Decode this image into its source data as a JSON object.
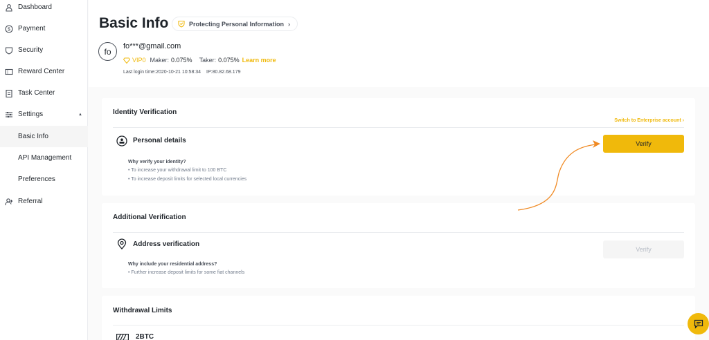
{
  "sidebar": {
    "items": [
      {
        "label": "Dashboard",
        "icon": "user-icon"
      },
      {
        "label": "Payment",
        "icon": "dollar-icon"
      },
      {
        "label": "Security",
        "icon": "shield-icon"
      },
      {
        "label": "Reward Center",
        "icon": "ticket-icon"
      },
      {
        "label": "Task Center",
        "icon": "clipboard-icon"
      },
      {
        "label": "Settings",
        "icon": "sliders-icon"
      },
      {
        "label": "Basic Info"
      },
      {
        "label": "API Management"
      },
      {
        "label": "Preferences"
      },
      {
        "label": "Referral",
        "icon": "add-user-icon"
      }
    ],
    "settings_caret": "▲"
  },
  "header": {
    "title": "Basic Info",
    "protect_chip": "Protecting Personal Information",
    "protect_chevron": "›",
    "avatar_initials": "fo",
    "email": "fo***@gmail.com",
    "vip_label": "VIP0",
    "maker_label": "Maker:",
    "maker_value": "0.075%",
    "taker_label": "Taker:",
    "taker_value": "0.075%",
    "learn_more": "Learn more",
    "last_login": "Last login time:2020-10-21 10:58:34",
    "ip": "IP:80.82.68.179"
  },
  "identity": {
    "title": "Identity Verification",
    "enterprise_link": "Switch to Enterprise account  ›",
    "row_title": "Personal details",
    "verify_label": "Verify",
    "why": "Why verify your identity?",
    "bullets": [
      "• To increase your withdrawal limit to 100 BTC",
      "• To increase deposit limits for selected local currencies"
    ]
  },
  "additional": {
    "title": "Additional Verification",
    "row_title": "Address verification",
    "verify_label": "Verify",
    "why": "Why include your residential address?",
    "bullets": [
      "• Further increase deposit limits for some fiat channels"
    ]
  },
  "withdrawal": {
    "title": "Withdrawal Limits",
    "row_value": "2BTC"
  },
  "colors": {
    "accent": "#f0b90b",
    "arrow": "#f08a24"
  }
}
